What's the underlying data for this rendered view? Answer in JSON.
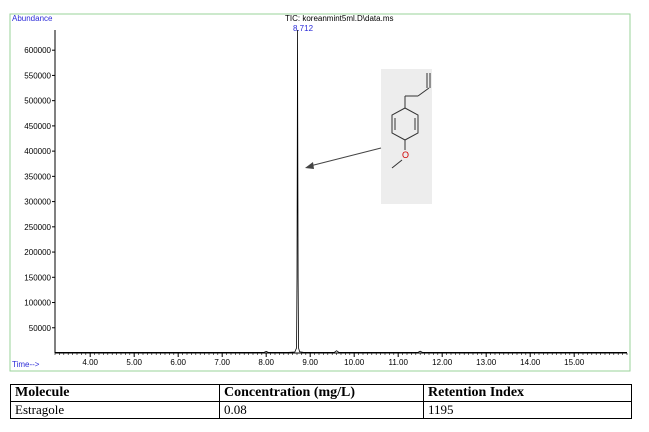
{
  "chart_data": {
    "type": "line",
    "title": "TIC: koreanmint5ml.D\\data.ms",
    "ylabel": "Abundance",
    "xlabel": "Time-->",
    "xlim": [
      3.2,
      16.2
    ],
    "ylim": [
      0,
      640000
    ],
    "xticks": [
      "4.00",
      "5.00",
      "6.00",
      "7.00",
      "8.00",
      "9.00",
      "10.00",
      "11.00",
      "12.00",
      "13.00",
      "14.00",
      "15.00"
    ],
    "yticks": [
      "50000",
      "100000",
      "150000",
      "200000",
      "250000",
      "300000",
      "350000",
      "400000",
      "450000",
      "500000",
      "550000",
      "600000"
    ],
    "peak_label": "8.712",
    "series": [
      {
        "x": [
          3.2,
          4.5,
          6.0,
          7.5,
          7.95,
          8.0,
          8.05,
          8.5,
          8.65,
          8.69,
          8.7,
          8.712,
          8.725,
          8.735,
          8.76,
          8.85,
          9.55,
          9.6,
          9.65,
          11.0,
          11.45,
          11.5,
          11.55,
          13.0,
          16.2
        ],
        "values": [
          1200,
          1200,
          1200,
          1200,
          1300,
          3000,
          1300,
          1300,
          2000,
          10000,
          150000,
          640000,
          150000,
          10000,
          2500,
          1300,
          1300,
          4500,
          1300,
          1300,
          1300,
          3500,
          1300,
          1200,
          1200
        ]
      }
    ]
  },
  "table": {
    "headers": [
      "Molecule",
      "Concentration (mg/L)",
      "Retention Index"
    ],
    "rows": [
      [
        "Estragole",
        "0.08",
        "1195"
      ]
    ]
  },
  "inset": {
    "atom_label": "O"
  }
}
